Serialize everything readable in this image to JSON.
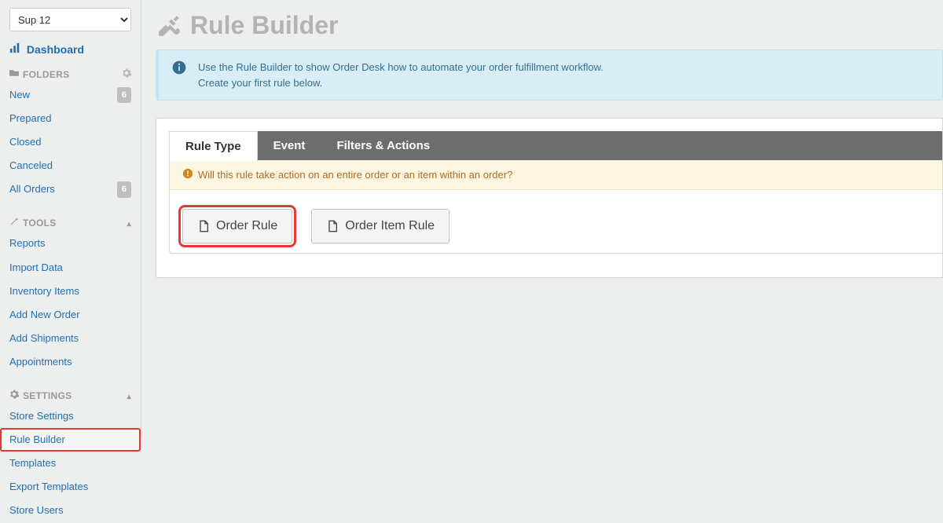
{
  "sidebar": {
    "store_selector_value": "Sup 12",
    "dashboard_label": "Dashboard",
    "folders": {
      "header": "FOLDERS",
      "items": [
        {
          "label": "New",
          "badge": "6"
        },
        {
          "label": "Prepared",
          "badge": ""
        },
        {
          "label": "Closed",
          "badge": ""
        },
        {
          "label": "Canceled",
          "badge": ""
        },
        {
          "label": "All Orders",
          "badge": "6"
        }
      ]
    },
    "tools": {
      "header": "TOOLS",
      "items": [
        {
          "label": "Reports"
        },
        {
          "label": "Import Data"
        },
        {
          "label": "Inventory Items"
        },
        {
          "label": "Add New Order"
        },
        {
          "label": "Add Shipments"
        },
        {
          "label": "Appointments"
        }
      ]
    },
    "settings": {
      "header": "SETTINGS",
      "items": [
        {
          "label": "Store Settings"
        },
        {
          "label": "Rule Builder"
        },
        {
          "label": "Templates"
        },
        {
          "label": "Export Templates"
        },
        {
          "label": "Store Users"
        }
      ]
    }
  },
  "main": {
    "title": "Rule Builder",
    "info_line1": "Use the Rule Builder to show Order Desk how to automate your order fulfillment workflow.",
    "info_line2": "Create your first rule below.",
    "tabs": {
      "rule_type": "Rule Type",
      "event": "Event",
      "filters_actions": "Filters & Actions"
    },
    "hint": "Will this rule take action on an entire order or an item within an order?",
    "buttons": {
      "order_rule": "Order Rule",
      "order_item_rule": "Order Item Rule"
    }
  }
}
